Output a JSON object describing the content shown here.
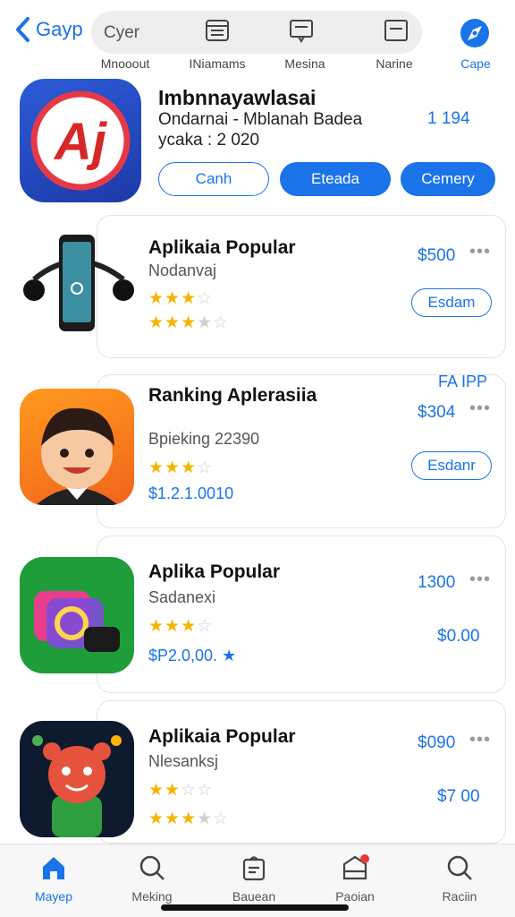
{
  "header": {
    "back_label": "Gayp",
    "search_text": "Cyer",
    "icons": [
      {
        "icon": "list-icon",
        "label": "Mnooout"
      },
      {
        "icon": "message-icon",
        "label": "INiamams"
      },
      {
        "icon": "note-icon",
        "label": "Mesina"
      }
    ],
    "extra_label": "Narine",
    "cape_label": "Cape"
  },
  "featured": {
    "title": "Imbnnayawlasai",
    "subtitle": "Ondarnai - Mblanah Badea",
    "year": "ycaka : 2 020",
    "price": "1 194",
    "buttons": [
      "Canh",
      "Eteada",
      "Cemery"
    ],
    "icon_text": "Aj"
  },
  "apps": [
    {
      "title": "Aplikaia Popular",
      "subtitle": "Nodanvaj",
      "rating1": 3,
      "rating2": 3,
      "price": "$500",
      "button": "Esdam"
    },
    {
      "title": "Ranking Aplerasiia",
      "subtitle": "Bpieking 22390",
      "rating1": 3,
      "meta": "$1.2.1.0010",
      "top_label": "FA IPP",
      "price": "$304",
      "button": "Esdanr"
    },
    {
      "title": "Aplika Popular",
      "subtitle": "Sadanexi",
      "rating1": 3,
      "meta": "$P2.0,00.",
      "price": "1300",
      "price2": "$0.00"
    },
    {
      "title": "Aplikaia Popular",
      "subtitle": "Nlesanksj",
      "rating1": 2,
      "rating2": 3,
      "price": "$090",
      "price2": "$7 00"
    }
  ],
  "tabs": [
    {
      "icon": "home-icon",
      "label": "Mayep",
      "active": true
    },
    {
      "icon": "search-icon",
      "label": "Meking",
      "active": false
    },
    {
      "icon": "bag-icon",
      "label": "Bauean",
      "active": false
    },
    {
      "icon": "box-icon",
      "label": "Paoian",
      "active": false,
      "badge": true
    },
    {
      "icon": "search-icon",
      "label": "Raciin",
      "active": false
    }
  ],
  "colors": {
    "accent": "#1a73e8",
    "star": "#f4b400",
    "badge": "#e53935"
  }
}
